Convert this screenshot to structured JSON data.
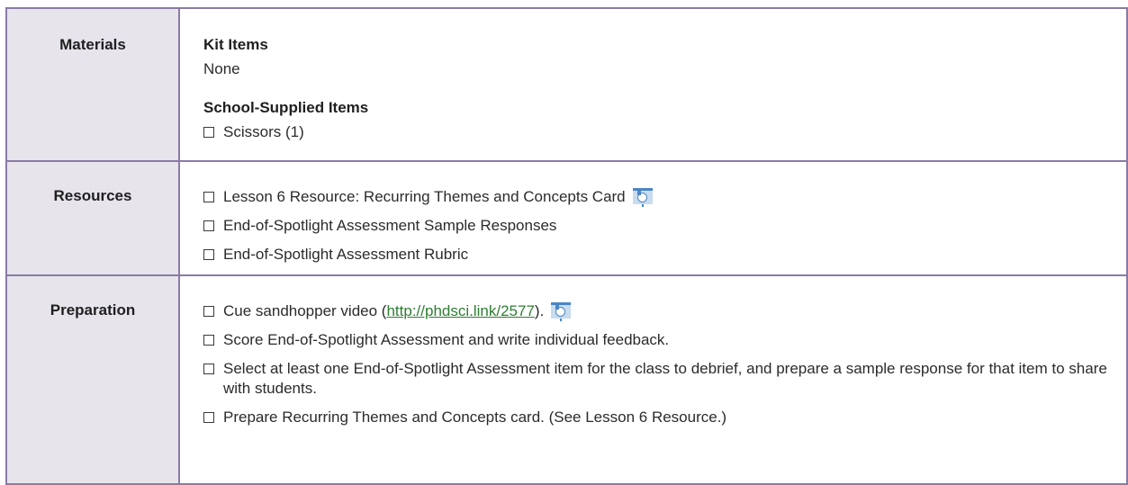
{
  "materials": {
    "label": "Materials",
    "kit_items_heading": "Kit Items",
    "kit_items_value": "None",
    "school_supplied_heading": "School-Supplied Items",
    "school_supplied_items": [
      {
        "text": "Scissors (1)"
      }
    ]
  },
  "resources": {
    "label": "Resources",
    "items": [
      {
        "text": "Lesson 6 Resource: Recurring Themes and Concepts Card",
        "icon": "projector-icon"
      },
      {
        "text": "End-of-Spotlight Assessment Sample Responses"
      },
      {
        "text": "End-of-Spotlight Assessment Rubric"
      }
    ]
  },
  "preparation": {
    "label": "Preparation",
    "items": [
      {
        "text_before": "Cue sandhopper video (",
        "link": "http://phdsci.link/2577",
        "text_after": ").",
        "icon": "projector-icon"
      },
      {
        "text": "Score End-of-Spotlight Assessment and write individual feedback."
      },
      {
        "text": "Select at least one End-of-Spotlight Assessment item for the class to debrief, and prepare a sample response for that item to share with students."
      },
      {
        "text": "Prepare Recurring Themes and Concepts card. (See Lesson 6 Resource.)"
      }
    ]
  },
  "colors": {
    "border": "#8a7aa6",
    "label_background": "#e7e4ec",
    "link": "#2e7d32",
    "icon": "#4a86c5"
  }
}
